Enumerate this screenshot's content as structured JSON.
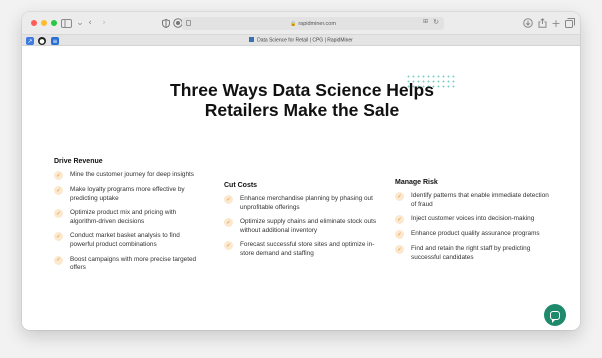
{
  "browser": {
    "url": "rapidminer.com",
    "tab_title": "Data Science for Retail | CPG | RapidMiner",
    "traffic_lights": [
      "#ff5f57",
      "#febc2e",
      "#28c840"
    ],
    "icons": [
      "sidebar-icon",
      "back-icon",
      "forward-icon",
      "shield-icon",
      "privacy-icon",
      "page-icon",
      "lock-icon",
      "translate-icon",
      "reload-icon",
      "download-icon",
      "share-icon",
      "new-tab-icon",
      "tab-overview-icon"
    ]
  },
  "page": {
    "headline": "Three Ways Data Science Helps Retailers Make the Sale",
    "columns": [
      {
        "title": "Drive Revenue",
        "items": [
          "Mine the customer journey for deep insights",
          "Make loyalty programs more effective by predicting uptake",
          "Optimize product mix and pricing with algorithm-driven decisions",
          "Conduct market basket analysis to find powerful product combinations",
          "Boost campaigns with more precise targeted offers"
        ]
      },
      {
        "title": "Cut Costs",
        "items": [
          "Enhance merchandise planning by phasing out unprofitable offerings",
          "Optimize supply chains and eliminate stock outs without additional inventory",
          "Forecast successful store sites and optimize in-store demand and staffing"
        ]
      },
      {
        "title": "Manage Risk",
        "items": [
          "Identify patterns that enable immediate detection of fraud",
          "Inject customer voices into decision-making",
          "Enhance product quality assurance programs",
          "Find and retain the right staff by predicting successful candidates"
        ]
      }
    ],
    "accent_color": "#e08a1e",
    "chat_color": "#1e8a6b"
  }
}
